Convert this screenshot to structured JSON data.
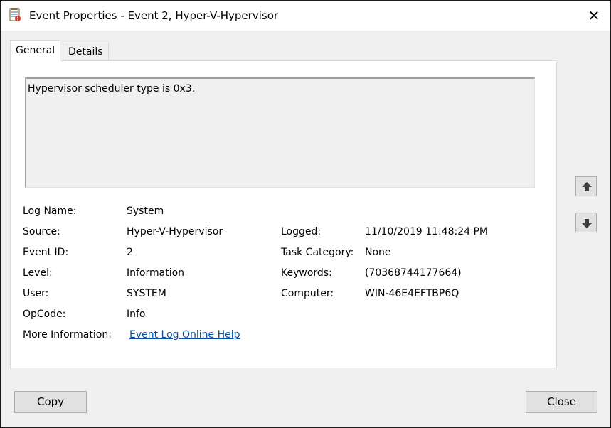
{
  "window": {
    "title": "Event Properties - Event 2, Hyper-V-Hypervisor",
    "close_glyph": "✕"
  },
  "tabs": [
    {
      "label": "General",
      "active": true
    },
    {
      "label": "Details",
      "active": false
    }
  ],
  "event": {
    "message": "Hypervisor scheduler type is 0x3.",
    "fields_left": [
      {
        "label": "Log Name:",
        "value": "System"
      },
      {
        "label": "Source:",
        "value": "Hyper-V-Hypervisor"
      },
      {
        "label": "Event ID:",
        "value": "2"
      },
      {
        "label": "Level:",
        "value": "Information"
      },
      {
        "label": "User:",
        "value": "SYSTEM"
      },
      {
        "label": "OpCode:",
        "value": "Info"
      }
    ],
    "fields_right": [
      {
        "label": "Logged:",
        "value": "11/10/2019 11:48:24 PM"
      },
      {
        "label": "Task Category:",
        "value": "None"
      },
      {
        "label": "Keywords:",
        "value": "(70368744177664)"
      },
      {
        "label": "Computer:",
        "value": "WIN-46E4EFTBP6Q"
      }
    ],
    "more_info": {
      "label": "More Information:",
      "link_text": "Event Log Online Help"
    }
  },
  "buttons": {
    "copy": "Copy",
    "close": "Close"
  },
  "icons": {
    "title": "event-log-icon",
    "up": "arrow-up-icon",
    "down": "arrow-down-icon"
  },
  "colors": {
    "link": "#0b4ea2",
    "background": "#f0f0f0",
    "panel": "#ffffff"
  }
}
